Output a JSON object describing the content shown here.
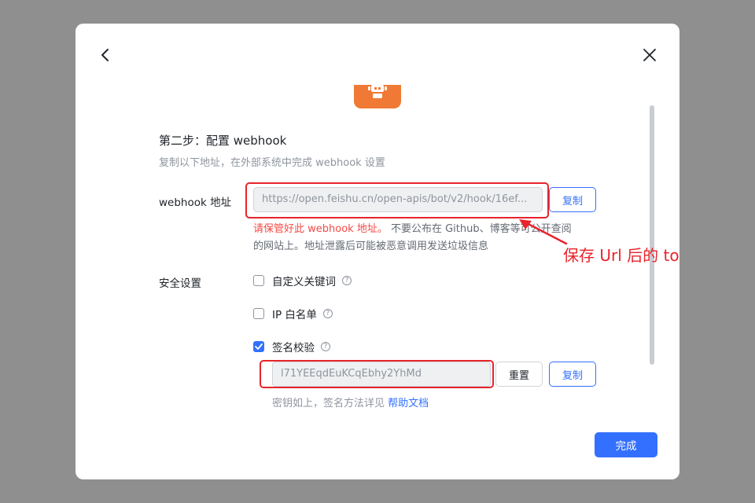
{
  "dialog": {
    "back_icon": "chevron-left-icon",
    "close_icon": "close-icon",
    "bot_icon": "robot-icon",
    "accent_color": "#3370ff",
    "warning_color": "#f54a45",
    "bot_icon_color": "#f07a35"
  },
  "step": {
    "title": "第二步：配置 webhook",
    "description": "复制以下地址，在外部系统中完成 webhook 设置"
  },
  "webhook": {
    "label": "webhook 地址",
    "url": "https://open.feishu.cn/open-apis/bot/v2/hook/16ef...",
    "copy_label": "复制",
    "warning_red": "请保管好此 webhook 地址。",
    "warning_rest": " 不要公布在 Github、博客等可公开查阅",
    "warning_line2": "的网站上。地址泄露后可能被恶意调用发送垃圾信息"
  },
  "annotation": {
    "text": "保存 Url 后的 token"
  },
  "security": {
    "label": "安全设置",
    "options": [
      {
        "label": "自定义关键词",
        "checked": false
      },
      {
        "label": "IP 白名单",
        "checked": false
      },
      {
        "label": "签名校验",
        "checked": true
      }
    ],
    "help_icon": "question-circle-icon",
    "secret": "l71YEEqdEuKCqEbhy2YhMd",
    "reset_label": "重置",
    "copy_label": "复制",
    "hint_prefix": "密钥如上，签名方法详见 ",
    "hint_link": "帮助文档"
  },
  "footer": {
    "done_label": "完成"
  }
}
